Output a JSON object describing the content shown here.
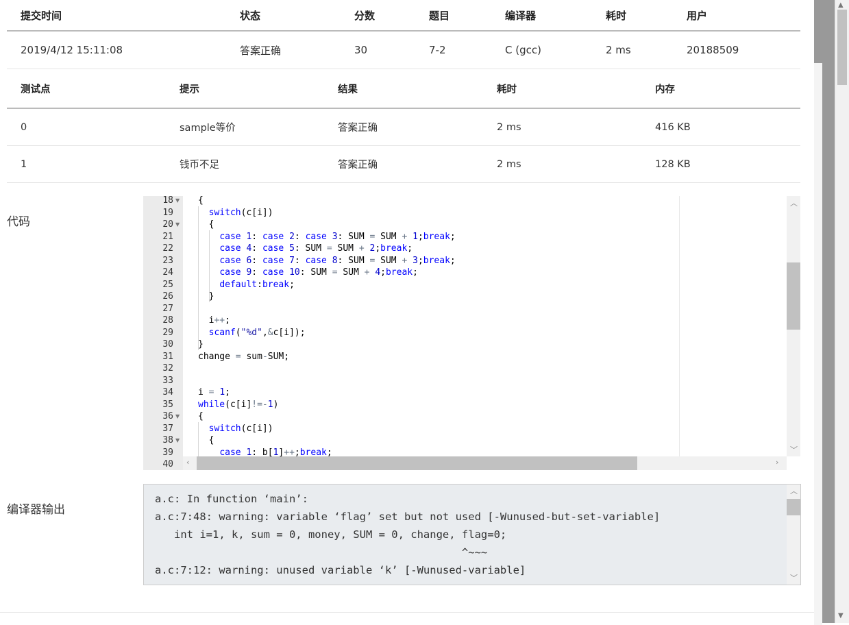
{
  "submission_table": {
    "headers": [
      "提交时间",
      "状态",
      "分数",
      "题目",
      "编译器",
      "耗时",
      "用户"
    ],
    "row": {
      "time": "2019/4/12 15:11:08",
      "status": "答案正确",
      "score": "30",
      "problem": "7-2",
      "compiler": "C (gcc)",
      "elapsed": "2 ms",
      "user": "20188509"
    }
  },
  "cases_table": {
    "headers": [
      "测试点",
      "提示",
      "结果",
      "耗时",
      "内存"
    ],
    "rows": [
      {
        "id": "0",
        "hint": "sample等价",
        "result": "答案正确",
        "elapsed": "2 ms",
        "memory": "416 KB"
      },
      {
        "id": "1",
        "hint": "钱币不足",
        "result": "答案正确",
        "elapsed": "2 ms",
        "memory": "128 KB"
      }
    ]
  },
  "code_label": "代码",
  "compiler_output_label": "编译器输出",
  "code": {
    "line_numbers": [
      "18",
      "19",
      "20",
      "21",
      "22",
      "23",
      "24",
      "25",
      "26",
      "27",
      "28",
      "29",
      "30",
      "31",
      "32",
      "33",
      "34",
      "35",
      "36",
      "37",
      "38",
      "39",
      "40"
    ],
    "fold_lines": [
      "18",
      "20",
      "36",
      "38"
    ]
  },
  "compiler_output": [
    "a.c: In function ‘main’:",
    "a.c:7:48: warning: variable ‘flag’ set but not used [-Wunused-but-set-variable]",
    "   int i=1, k, sum = 0, money, SUM = 0, change, flag=0;",
    "                                                ^~~~",
    "a.c:7:12: warning: unused variable ‘k’ [-Wunused-variable]"
  ],
  "colors": {
    "accepted": "#e74c3c",
    "link": "#2a6496",
    "keyword": "#0000ff"
  }
}
